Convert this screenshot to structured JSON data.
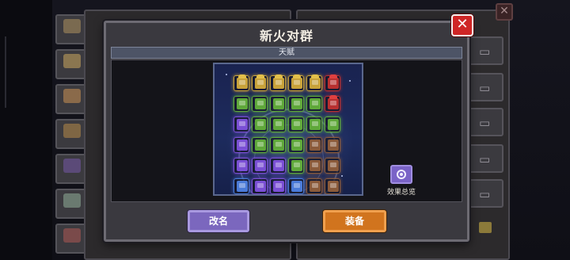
{
  "dialog": {
    "title": "新火对群",
    "section_label": "天赋",
    "effects_label": "效果总览",
    "rename_label": "改名",
    "equip_label": "装备",
    "close_symbol": "✕"
  },
  "background": {
    "side_tabs": [
      "",
      "",
      "",
      "",
      "",
      "",
      ""
    ],
    "bg_close_symbol": "✕",
    "shirt_glyph": "👕"
  },
  "colors": {
    "accent_purple": "#7b67be",
    "accent_orange": "#d1741e",
    "close_red": "#cf2626",
    "tier_yellow": "#c8a23a",
    "tier_green": "#5fa83a",
    "tier_purple": "#7a4fd4",
    "tier_red": "#b83030",
    "tier_brown": "#8a5a3a",
    "tier_blue": "#4a7ad8"
  },
  "talent_grid": {
    "rows": [
      [
        "yellow",
        "yellow",
        "yellow",
        "yellow",
        "yellow",
        "red"
      ],
      [
        "green",
        "green",
        "green",
        "green",
        "green",
        "red"
      ],
      [
        "purple",
        "green",
        "green",
        "green",
        "green",
        "green"
      ],
      [
        "purple",
        "green",
        "green",
        "green",
        "brown",
        "brown"
      ],
      [
        "purple",
        "purple",
        "purple",
        "green",
        "brown",
        "brown"
      ],
      [
        "blue",
        "purple",
        "purple",
        "blue",
        "brown",
        "brown"
      ]
    ]
  }
}
